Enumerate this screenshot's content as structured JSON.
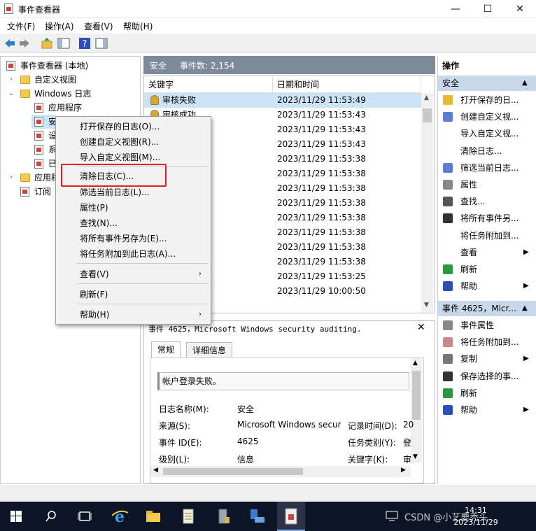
{
  "window": {
    "title": "事件查看器",
    "minimize": "—",
    "maximize": "☐",
    "close": "✕"
  },
  "menubar": [
    "文件(F)",
    "操作(A)",
    "查看(V)",
    "帮助(H)"
  ],
  "tree": {
    "root": "事件查看器 (本地)",
    "custom_views": "自定义视图",
    "windows_logs": "Windows 日志",
    "application": "应用程序",
    "security": "安",
    "setup": "设",
    "system": "系",
    "forwarded": "已",
    "apps_services": "应用程",
    "subscriptions": "订阅"
  },
  "center": {
    "log_name": "安全",
    "event_count": "事件数: 2,154",
    "columns": {
      "keyword": "关键字",
      "datetime": "日期和时间"
    },
    "rows": [
      {
        "keyword": "审核失败",
        "datetime": "2023/11/29 11:53:49"
      },
      {
        "keyword": "审核成功",
        "datetime": "2023/11/29 11:53:43"
      },
      {
        "keyword": "",
        "datetime": "2023/11/29 11:53:43"
      },
      {
        "keyword": "",
        "datetime": "2023/11/29 11:53:43"
      },
      {
        "keyword": "",
        "datetime": "2023/11/29 11:53:38"
      },
      {
        "keyword": "",
        "datetime": "2023/11/29 11:53:38"
      },
      {
        "keyword": "",
        "datetime": "2023/11/29 11:53:38"
      },
      {
        "keyword": "",
        "datetime": "2023/11/29 11:53:38"
      },
      {
        "keyword": "",
        "datetime": "2023/11/29 11:53:38"
      },
      {
        "keyword": "",
        "datetime": "2023/11/29 11:53:38"
      },
      {
        "keyword": "",
        "datetime": "2023/11/29 11:53:38"
      },
      {
        "keyword": "",
        "datetime": "2023/11/29 11:53:38"
      },
      {
        "keyword": "",
        "datetime": "2023/11/29 11:53:25"
      },
      {
        "keyword": "",
        "datetime": "2023/11/29 10:00:50"
      }
    ]
  },
  "detail": {
    "title": "事件 4625，Microsoft Windows security auditing.",
    "tab_general": "常规",
    "tab_details": "详细信息",
    "message": "帐户登录失败。",
    "log_name_label": "日志名称(M):",
    "log_name_value": "安全",
    "source_label": "来源(S):",
    "source_value": "Microsoft Windows secur",
    "logged_label": "记录时间(D):",
    "logged_value": "20",
    "event_id_label": "事件 ID(E):",
    "event_id_value": "4625",
    "task_label": "任务类别(Y):",
    "task_value": "登",
    "level_label": "级别(L):",
    "level_value": "信息",
    "keywords_label": "关键字(K):",
    "keywords_value": "审"
  },
  "context_menu": {
    "items": [
      "打开保存的日志(O)...",
      "创建自定义视图(R)...",
      "导入自定义视图(M)...",
      "清除日志(C)...",
      "筛选当前日志(L)...",
      "属性(P)",
      "查找(N)...",
      "将所有事件另存为(E)...",
      "将任务附加到此日志(A)...",
      "查看(V)",
      "刷新(F)",
      "帮助(H)"
    ]
  },
  "actions": {
    "header": "操作",
    "section1": "安全",
    "items1": [
      "打开保存的日...",
      "创建自定义视...",
      "导入自定义视...",
      "清除日志...",
      "筛选当前日志...",
      "属性",
      "查找...",
      "将所有事件另...",
      "将任务附加到...",
      "查看",
      "刷新",
      "帮助"
    ],
    "section2": "事件 4625，Micr...",
    "items2": [
      "事件属性",
      "将任务附加到...",
      "复制",
      "保存选择的事...",
      "刷新",
      "帮助"
    ]
  },
  "taskbar": {
    "time": "14:31",
    "date": "2023/11/29",
    "watermark": "CSDN @小艺要秃头"
  }
}
